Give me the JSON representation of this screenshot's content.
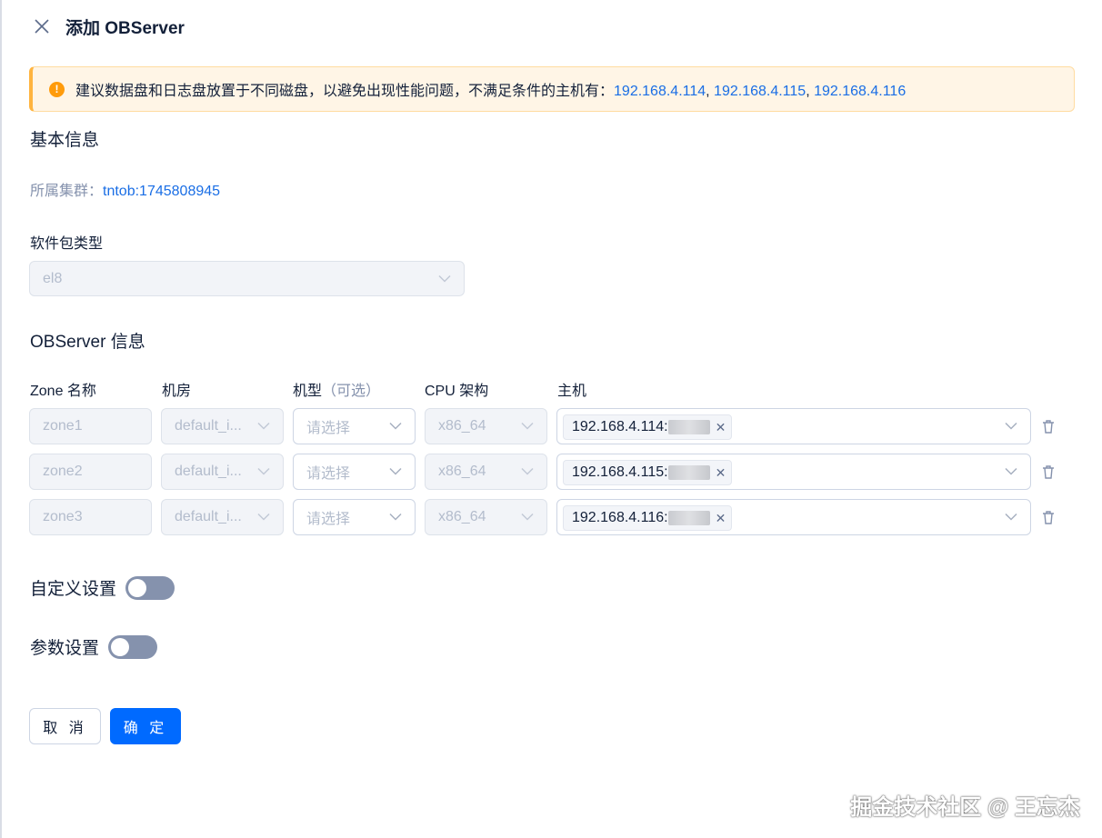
{
  "header": {
    "title": "添加 OBServer"
  },
  "alert": {
    "text": "建议数据盘和日志盘放置于不同磁盘，以避免出现性能问题，不满足条件的主机有：",
    "hosts": [
      "192.168.4.114",
      "192.168.4.115",
      "192.168.4.116"
    ],
    "separator": ", "
  },
  "basic": {
    "title": "基本信息",
    "cluster_label": "所属集群：",
    "cluster_value": "tntob:1745808945",
    "package_label": "软件包类型",
    "package_value": "el8"
  },
  "observer": {
    "title": "OBServer 信息",
    "columns": {
      "zone": "Zone 名称",
      "idc": "机房",
      "model": "机型",
      "model_optional": "（可选）",
      "cpu": "CPU 架构",
      "host": "主机"
    },
    "rows": [
      {
        "zone": "zone1",
        "idc": "default_i...",
        "model_placeholder": "请选择",
        "cpu": "x86_64",
        "host": "192.168.4.114:"
      },
      {
        "zone": "zone2",
        "idc": "default_i...",
        "model_placeholder": "请选择",
        "cpu": "x86_64",
        "host": "192.168.4.115:"
      },
      {
        "zone": "zone3",
        "idc": "default_i...",
        "model_placeholder": "请选择",
        "cpu": "x86_64",
        "host": "192.168.4.116:"
      }
    ]
  },
  "switches": {
    "custom_label": "自定义设置",
    "custom_on": false,
    "params_label": "参数设置",
    "params_on": false
  },
  "buttons": {
    "cancel": "取 消",
    "confirm": "确 定"
  },
  "watermark": "掘金技术社区 @ 王忘杰",
  "colors": {
    "primary": "#006aff",
    "link": "#1a6ee5",
    "warning": "#ff9b0b",
    "alert_bg": "#fff5e6"
  },
  "icons": {
    "close": "close-icon",
    "warning": "warning-icon",
    "chevron": "chevron-down-icon",
    "delete": "trash-icon"
  }
}
